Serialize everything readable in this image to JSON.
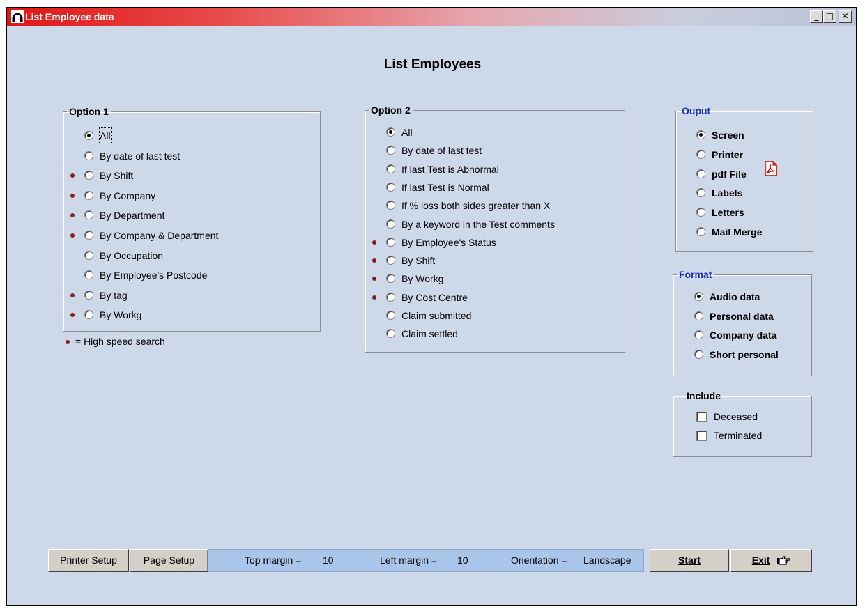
{
  "window": {
    "title": "List Employee data",
    "controls": {
      "minimize": "_",
      "maximize": "□",
      "close": "✕"
    }
  },
  "heading": "List Employees",
  "option1": {
    "legend": "Option 1",
    "items": [
      {
        "label": "All",
        "selected": true,
        "high_speed": false
      },
      {
        "label": "By date of last test",
        "selected": false,
        "high_speed": false
      },
      {
        "label": "By Shift",
        "selected": false,
        "high_speed": true
      },
      {
        "label": "By Company",
        "selected": false,
        "high_speed": true
      },
      {
        "label": "By Department",
        "selected": false,
        "high_speed": true
      },
      {
        "label": "By Company & Department",
        "selected": false,
        "high_speed": true
      },
      {
        "label": "By Occupation",
        "selected": false,
        "high_speed": false
      },
      {
        "label": "By Employee's Postcode",
        "selected": false,
        "high_speed": false
      },
      {
        "label": "By tag",
        "selected": false,
        "high_speed": true
      },
      {
        "label": "By Workg",
        "selected": false,
        "high_speed": true
      }
    ],
    "note": "= High speed search"
  },
  "option2": {
    "legend": "Option 2",
    "items": [
      {
        "label": "All",
        "selected": true,
        "high_speed": false
      },
      {
        "label": "By date of last test",
        "selected": false,
        "high_speed": false
      },
      {
        "label": "If last Test is Abnormal",
        "selected": false,
        "high_speed": false
      },
      {
        "label": "If last Test is Normal",
        "selected": false,
        "high_speed": false
      },
      {
        "label": "If % loss both sides greater than X",
        "selected": false,
        "high_speed": false
      },
      {
        "label": "By a keyword in the Test comments",
        "selected": false,
        "high_speed": false
      },
      {
        "label": "By Employee's Status",
        "selected": false,
        "high_speed": true
      },
      {
        "label": "By Shift",
        "selected": false,
        "high_speed": true
      },
      {
        "label": "By Workg",
        "selected": false,
        "high_speed": true
      },
      {
        "label": "By Cost Centre",
        "selected": false,
        "high_speed": true
      },
      {
        "label": "Claim submitted",
        "selected": false,
        "high_speed": false
      },
      {
        "label": "Claim settled",
        "selected": false,
        "high_speed": false
      }
    ]
  },
  "output": {
    "legend": "Ouput",
    "items": [
      {
        "label": "Screen",
        "selected": true
      },
      {
        "label": "Printer",
        "selected": false
      },
      {
        "label": "pdf File",
        "selected": false
      },
      {
        "label": "Labels",
        "selected": false
      },
      {
        "label": "Letters",
        "selected": false
      },
      {
        "label": "Mail Merge",
        "selected": false
      }
    ]
  },
  "format": {
    "legend": "Format",
    "items": [
      {
        "label": "Audio data",
        "selected": true
      },
      {
        "label": "Personal data",
        "selected": false
      },
      {
        "label": "Company data",
        "selected": false
      },
      {
        "label": "Short personal",
        "selected": false
      }
    ]
  },
  "include": {
    "legend": "Include",
    "items": [
      {
        "label": "Deceased",
        "checked": false
      },
      {
        "label": "Terminated",
        "checked": false
      }
    ]
  },
  "bottom": {
    "printer_setup": "Printer Setup",
    "page_setup": "Page Setup",
    "top_margin_label": "Top margin =",
    "top_margin_value": "10",
    "left_margin_label": "Left margin =",
    "left_margin_value": "10",
    "orientation_label": "Orientation =",
    "orientation_value": "Landscape",
    "start": "Start",
    "exit": "Exit"
  },
  "colors": {
    "window_bg": "#cdd8e8",
    "title_start": "#e01616",
    "legend_blue": "#1c2fb0",
    "high_speed_dot": "#8b1a1a",
    "margin_bar": "#a9c5ea"
  }
}
